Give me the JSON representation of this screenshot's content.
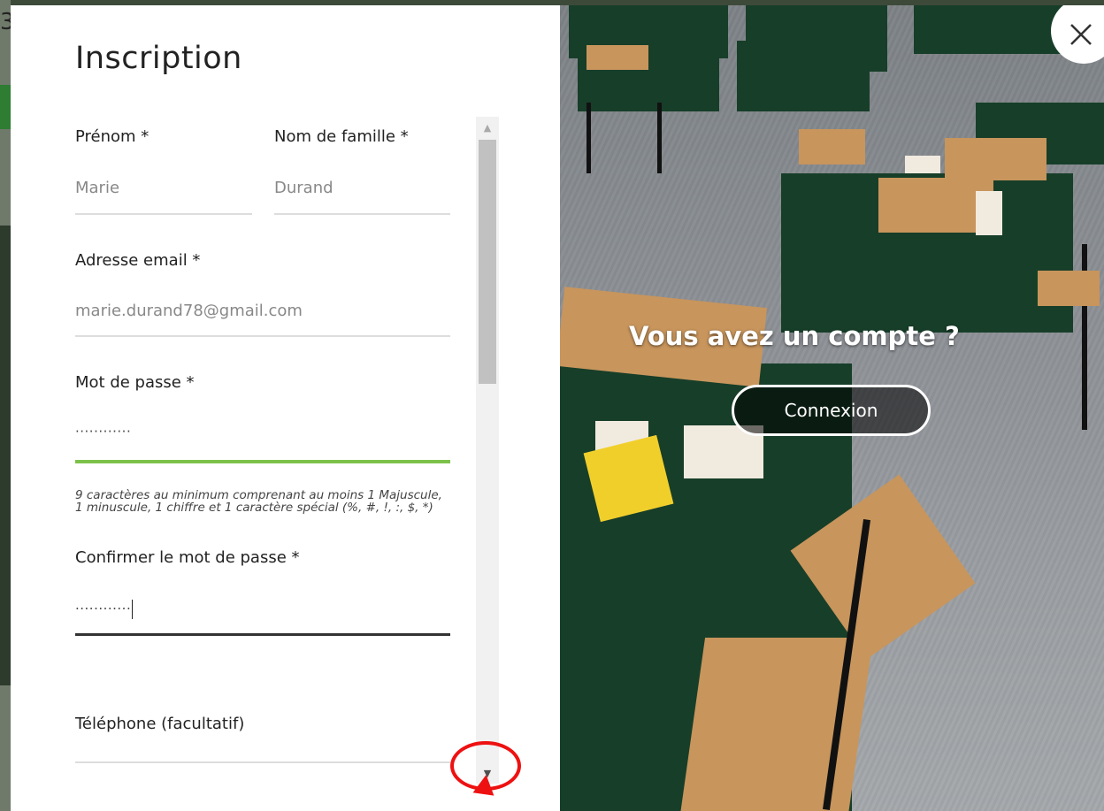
{
  "background": {
    "partial_char": "3"
  },
  "form": {
    "title": "Inscription",
    "first_name": {
      "label": "Prénom *",
      "value": "Marie"
    },
    "last_name": {
      "label": "Nom de famille *",
      "value": "Durand"
    },
    "email": {
      "label": "Adresse email *",
      "value": "marie.durand78@gmail.com"
    },
    "password": {
      "label": "Mot de passe *",
      "value": "············"
    },
    "password_help": "9 caractères au minimum comprenant au moins 1 Majuscule, 1 minuscule, 1 chiffre et 1 caractère spécial (%, #, !, :, $, *)",
    "confirm_password": {
      "label": "Confirmer le mot de passe *",
      "value": "············"
    },
    "phone": {
      "label": "Téléphone (facultatif)"
    }
  },
  "login_panel": {
    "heading": "Vous avez un compte ?",
    "button_label": "Connexion"
  },
  "colors": {
    "strength_bar": "#7cc24a",
    "highlight": "#ee1111",
    "table_cloth": "#173e29"
  }
}
